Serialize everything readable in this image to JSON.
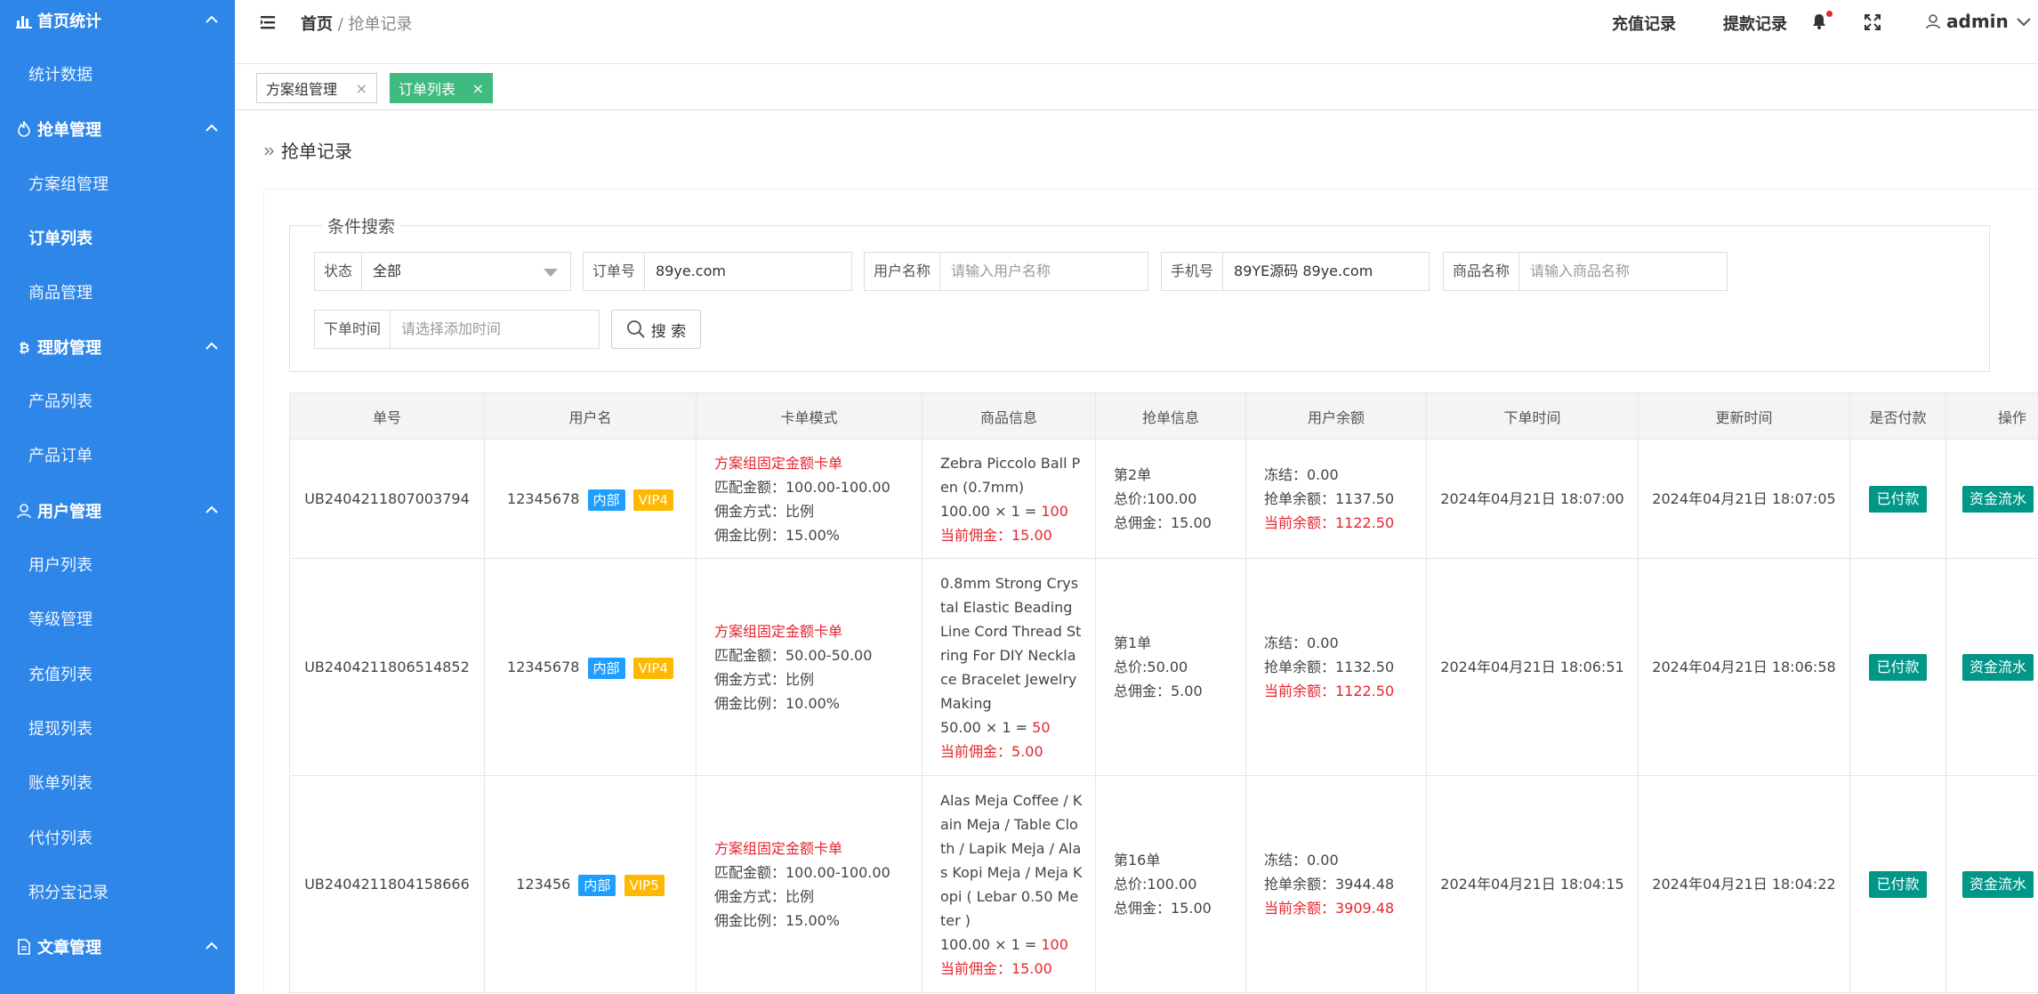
{
  "sidebar": {
    "groups": [
      {
        "label": "首页统计",
        "icon": "bar-chart-icon",
        "items": [
          "统计数据"
        ]
      },
      {
        "label": "抢单管理",
        "icon": "fire-icon",
        "items": [
          "方案组管理",
          "订单列表",
          "商品管理"
        ]
      },
      {
        "label": "理财管理",
        "icon": "bitcoin-icon",
        "items": [
          "产品列表",
          "产品订单"
        ]
      },
      {
        "label": "用户管理",
        "icon": "user-icon",
        "items": [
          "用户列表",
          "等级管理",
          "充值列表",
          "提现列表",
          "账单列表",
          "代付列表",
          "积分宝记录"
        ]
      },
      {
        "label": "文章管理",
        "icon": "document-icon",
        "items": []
      }
    ],
    "active_item": "订单列表"
  },
  "header": {
    "breadcrumb_home": "首页",
    "breadcrumb_sep": "/",
    "breadcrumb_current": "抢单记录",
    "recharge_link": "充值记录",
    "withdraw_link": "提款记录",
    "user": "admin"
  },
  "tabs": [
    {
      "label": "方案组管理",
      "close": "×",
      "active": false
    },
    {
      "label": "订单列表",
      "close": "×",
      "active": true
    }
  ],
  "page": {
    "title": "抢单记录",
    "legend": "条件搜索"
  },
  "search": {
    "status_label": "状态",
    "status_value": "全部",
    "order_label": "订单号",
    "order_value": "89ye.com",
    "username_label": "用户名称",
    "username_placeholder": "请输入用户名称",
    "phone_label": "手机号",
    "phone_value": "89YE源码 89ye.com",
    "goods_label": "商品名称",
    "goods_placeholder": "请输入商品名称",
    "time_label": "下单时间",
    "time_placeholder": "请选择添加时间",
    "button": "搜 索"
  },
  "table": {
    "headers": [
      "单号",
      "用户名",
      "卡单模式",
      "商品信息",
      "抢单信息",
      "用户余额",
      "下单时间",
      "更新时间",
      "是否付款",
      "操作"
    ],
    "rows": [
      {
        "order_no": "UB2404211807003794",
        "username": "12345678",
        "tag1": "内部",
        "tag2": "VIP4",
        "mode_title": "方案组固定金额卡单",
        "mode_lines": [
          "匹配金额：100.00-100.00",
          "佣金方式：比例",
          "佣金比例：15.00%"
        ],
        "goods_name": "Zebra Piccolo Ball Pen (0.7mm)",
        "goods_calc": "100.00 × 1 = ",
        "goods_total": "100",
        "goods_comm": "当前佣金：15.00",
        "grab_lines": [
          "第2单",
          "总价:100.00",
          "总佣金：15.00"
        ],
        "bal_lines": [
          "冻结：0.00",
          "抢单余额：1137.50"
        ],
        "bal_current": "当前余额：1122.50",
        "order_time": "2024年04月21日 18:07:00",
        "update_time": "2024年04月21日 18:07:05",
        "paid": "已付款",
        "op": "资金流水"
      },
      {
        "order_no": "UB2404211806514852",
        "username": "12345678",
        "tag1": "内部",
        "tag2": "VIP4",
        "mode_title": "方案组固定金额卡单",
        "mode_lines": [
          "匹配金额：50.00-50.00",
          "佣金方式：比例",
          "佣金比例：10.00%"
        ],
        "goods_name": "0.8mm Strong Crystal Elastic Beading Line Cord Thread String For DIY Necklace Bracelet Jewelry Making",
        "goods_calc": "50.00 × 1 = ",
        "goods_total": "50",
        "goods_comm": "当前佣金：5.00",
        "grab_lines": [
          "第1单",
          "总价:50.00",
          "总佣金：5.00"
        ],
        "bal_lines": [
          "冻结：0.00",
          "抢单余额：1132.50"
        ],
        "bal_current": "当前余额：1122.50",
        "order_time": "2024年04月21日 18:06:51",
        "update_time": "2024年04月21日 18:06:58",
        "paid": "已付款",
        "op": "资金流水"
      },
      {
        "order_no": "UB2404211804158666",
        "username": "123456",
        "tag1": "内部",
        "tag2": "VIP5",
        "mode_title": "方案组固定金额卡单",
        "mode_lines": [
          "匹配金额：100.00-100.00",
          "佣金方式：比例",
          "佣金比例：15.00%"
        ],
        "goods_name": "Alas Meja Coffee / Kain Meja / Table Cloth / Lapik Meja / Alas Kopi Meja / Meja Kopi ( Lebar 0.50 Meter )",
        "goods_calc": "100.00 × 1 = ",
        "goods_total": "100",
        "goods_comm": "当前佣金：15.00",
        "grab_lines": [
          "第16单",
          "总价:100.00",
          "总佣金：15.00"
        ],
        "bal_lines": [
          "冻结：0.00",
          "抢单余额：3944.48"
        ],
        "bal_current": "当前余额：3909.48",
        "order_time": "2024年04月21日 18:04:15",
        "update_time": "2024年04月21日 18:04:22",
        "paid": "已付款",
        "op": "资金流水"
      }
    ]
  }
}
